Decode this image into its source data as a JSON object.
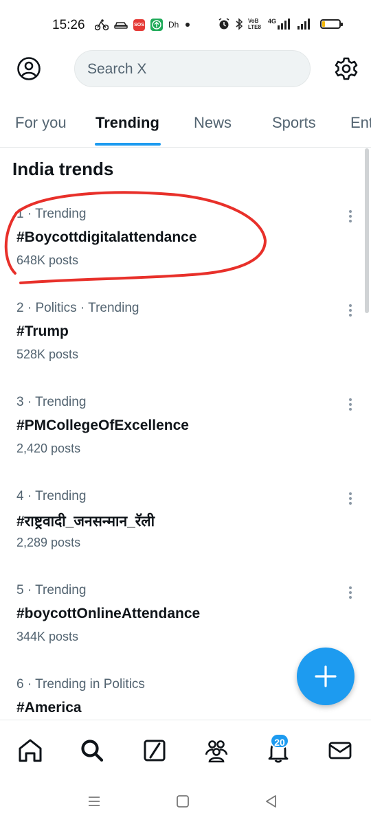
{
  "status_bar": {
    "time": "15:26",
    "sos_label": "SOS",
    "network_text": "Dh",
    "vo_label": "VoB LTE8",
    "net_gen": "4G",
    "battery_level": 0.18,
    "battery_color": "#f2b705"
  },
  "header": {
    "search_placeholder": "Search X",
    "profile_icon": "profile-icon",
    "settings_icon": "gear-icon"
  },
  "tabs": [
    {
      "label": "For you"
    },
    {
      "label": "Trending"
    },
    {
      "label": "News"
    },
    {
      "label": "Sports"
    },
    {
      "label": "Ent"
    }
  ],
  "active_tab": "Trending",
  "section_title": "India trends",
  "trends": [
    {
      "meta": "1 · Trending",
      "name": "#Boycottdigitalattendance",
      "posts": "648K posts"
    },
    {
      "meta": "2 · Politics · Trending",
      "name": "#Trump",
      "posts": "528K posts"
    },
    {
      "meta": "3 · Trending",
      "name": "#PMCollegeOfExcellence",
      "posts": "2,420 posts"
    },
    {
      "meta": "4 · Trending",
      "name": "#राष्ट्रवादी_जनसन्मान_रॅली",
      "posts": "2,289 posts"
    },
    {
      "meta": "5 · Trending",
      "name": "#boycottOnlineAttendance",
      "posts": "344K posts"
    },
    {
      "meta": "6 · Trending in Politics",
      "name": "#America",
      "posts": ""
    }
  ],
  "notifications_badge": "20",
  "colors": {
    "accent": "#1d9bf0",
    "annotation": "#e8302a",
    "secondary_text": "#536471"
  }
}
